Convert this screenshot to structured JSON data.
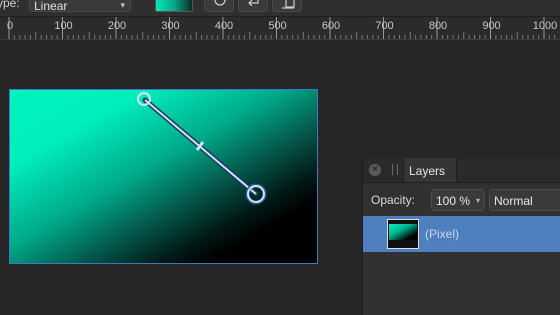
{
  "toolbar": {
    "type_label": "ype:",
    "type_value": "Linear",
    "type_chevron": "▾"
  },
  "ruler": {
    "labels": [
      "0",
      "100",
      "200",
      "300",
      "400",
      "500",
      "600",
      "700",
      "800",
      "900",
      "1000"
    ]
  },
  "layers_panel": {
    "close_glyph": "×",
    "tab_label": "Layers",
    "opacity_label": "Opacity:",
    "opacity_value": "100 %",
    "opacity_chevron": "▾",
    "blend_mode": "Normal",
    "layers": [
      {
        "name": "(Pixel)",
        "selected": true
      }
    ]
  },
  "colors": {
    "gradient_start": "#00f2c0",
    "gradient_end": "#000000",
    "selection_blue": "#4f7fbf",
    "handle": "#cfe3ff"
  }
}
